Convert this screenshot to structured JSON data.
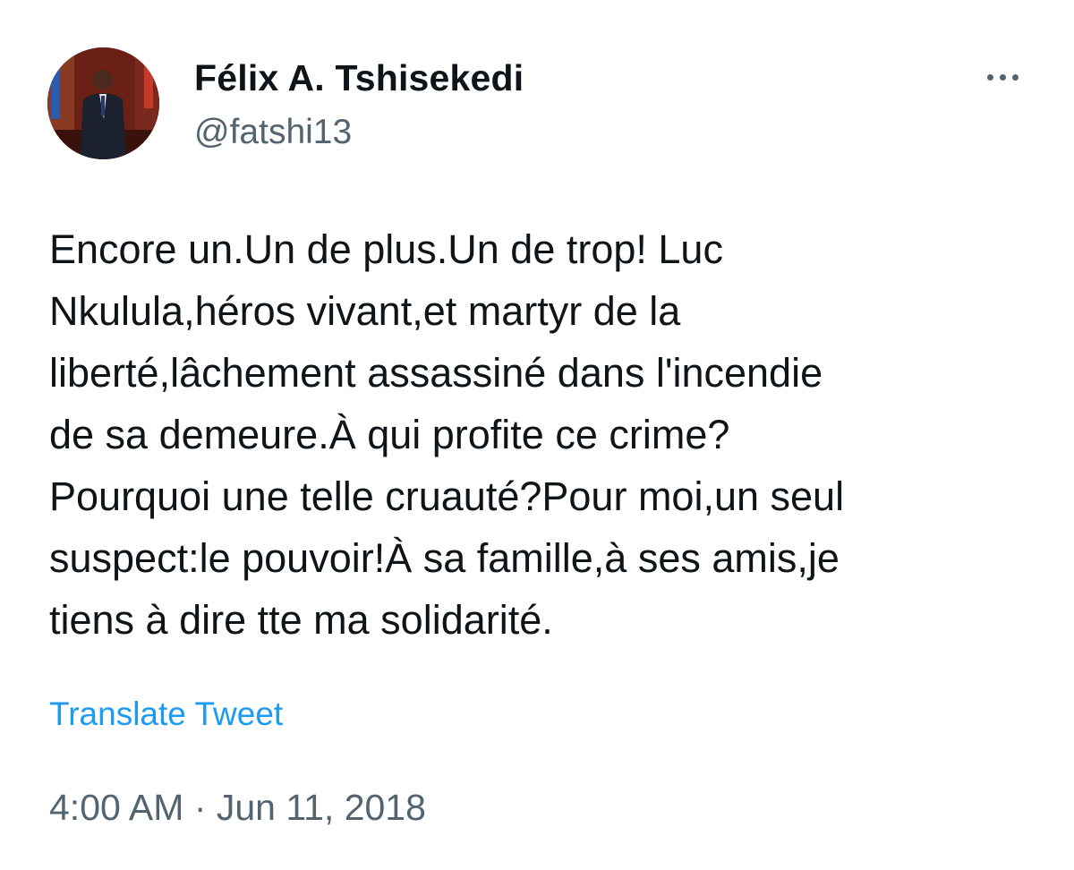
{
  "author": {
    "name": "Félix A. Tshisekedi",
    "handle": "@fatshi13"
  },
  "tweet": {
    "lines": [
      "Encore un.Un de plus.Un de trop! Luc",
      "Nkulula,héros vivant,et martyr de la",
      "liberté,lâchement assassiné dans l'incendie",
      "de sa demeure.À qui profite ce crime?",
      "Pourquoi une telle cruauté?Pour moi,un seul",
      "suspect:le pouvoir!À sa famille,à ses amis,je",
      "tiens à dire tte ma solidarité."
    ],
    "translate_label": "Translate Tweet",
    "timestamp": "4:00 AM · Jun 11, 2018"
  },
  "icons": {
    "more": "more-horizontal-icon"
  },
  "colors": {
    "text": "#0f1419",
    "secondary": "#536471",
    "link": "#1d9bf0"
  }
}
